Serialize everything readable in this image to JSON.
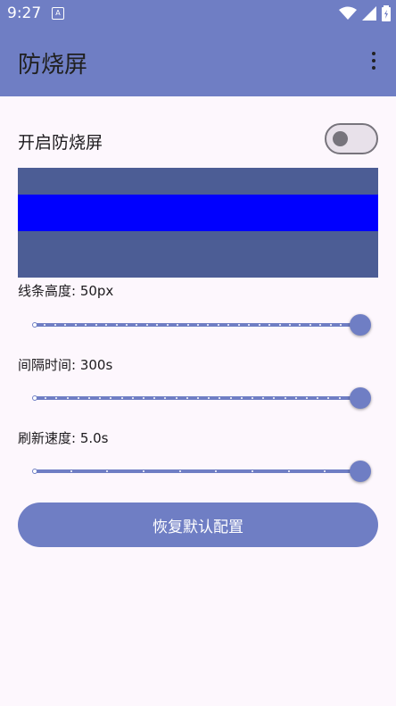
{
  "status_bar": {
    "time": "9:27",
    "notification_icon": "A",
    "icons": [
      "wifi-icon",
      "signal-icon",
      "battery-icon"
    ]
  },
  "app_bar": {
    "title": "防烧屏",
    "menu_icon": "more-vert-icon"
  },
  "toggle": {
    "label": "开启防烧屏",
    "enabled": false
  },
  "preview": {
    "background_color": "#4c5d95",
    "line_color": "#0000ff"
  },
  "settings": [
    {
      "label": "线条高度: 50px",
      "level": 1.0,
      "ticks": 32
    },
    {
      "label": "间隔时间: 300s",
      "level": 1.0,
      "ticks": 30
    },
    {
      "label": "刷新速度: 5.0s",
      "level": 1.0,
      "ticks": 9
    }
  ],
  "reset_button": {
    "label": "恢复默认配置"
  },
  "colors": {
    "accent": "#6f7ec4",
    "background": "#fdf7fd"
  }
}
